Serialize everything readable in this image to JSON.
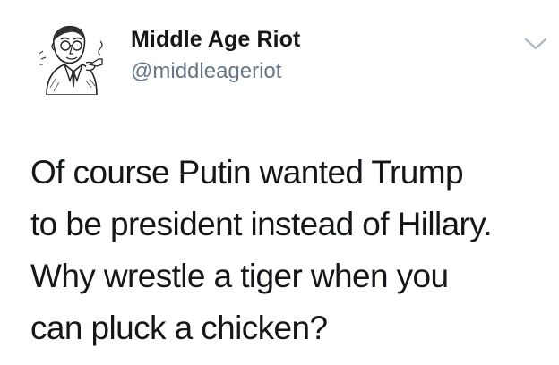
{
  "author": {
    "display_name": "Middle Age Riot",
    "handle": "@middleageriot",
    "avatar_icon": "vintage-man-smoking-pipe-avatar"
  },
  "menu": {
    "icon": "chevron-down-icon"
  },
  "tweet": {
    "lines": [
      "Of course Putin wanted Trump",
      "to be president instead of Hillary.",
      "Why wrestle a tiger when you",
      "can pluck a chicken?"
    ]
  },
  "colors": {
    "name": "#14171a",
    "handle": "#657786",
    "caret": "#aab8c2",
    "background": "#ffffff"
  }
}
